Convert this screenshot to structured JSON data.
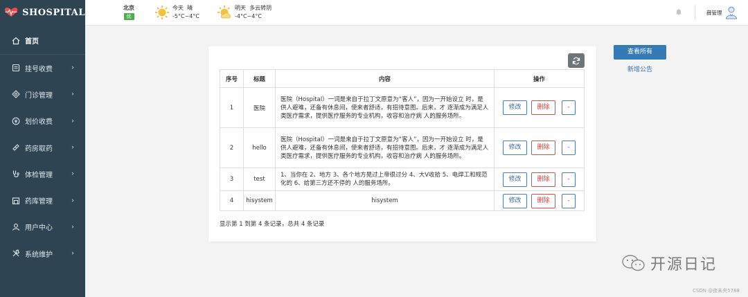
{
  "app": {
    "brand": "SHOSPITAL"
  },
  "sidebar": {
    "home": {
      "label": "首页",
      "icon": "home-icon"
    },
    "items": [
      {
        "label": "挂号收费",
        "icon": "register-icon"
      },
      {
        "label": "门诊管理",
        "icon": "clinic-icon"
      },
      {
        "label": "划价收费",
        "icon": "pricing-icon"
      },
      {
        "label": "药房取药",
        "icon": "pharmacy-icon"
      },
      {
        "label": "体检管理",
        "icon": "checkup-icon"
      },
      {
        "label": "药库管理",
        "icon": "warehouse-icon"
      },
      {
        "label": "用户中心",
        "icon": "user-icon"
      },
      {
        "label": "系统维护",
        "icon": "tools-icon"
      }
    ]
  },
  "topbar": {
    "city": "北京",
    "aqi": "优",
    "weather_today": {
      "day": "今天",
      "condition": "晴",
      "temp": "-5°C~4°C"
    },
    "weather_tomorrow": {
      "day": "明天",
      "condition": "多云转阴",
      "temp": "-4°C~4°C"
    },
    "user": "薛管理"
  },
  "table": {
    "headers": [
      "序号",
      "标题",
      "内容",
      "操作"
    ],
    "edit_label": "修改",
    "delete_label": "删除",
    "more_label": "-",
    "rows": [
      {
        "index": "1",
        "title": "医院",
        "content": "医院（Hospital）一词是来自于拉丁文原意为“客人”，因为一开始设立 时，是供人避难，还备有休息间，使来者舒适，有招待意图。后来，才 逐渐成为满足人类医疗需求，提供医疗服务的专业机构，收容和治疗病 人的服务场所。"
      },
      {
        "index": "2",
        "title": "hello",
        "content": "医院（Hospital）一词是来自于拉丁文原意为“客人”，因为一开始设立 时，是供人避难，还备有休息间，使来者舒适，有招待意图。后来，才 逐渐成为满足人类医疗需求，提供医疗服务的专业机构，收容和治疗病 人的服务场所。"
      },
      {
        "index": "3",
        "title": "test",
        "content": "1、当你在 2、地方 3、各个地方晃过上帝很过分 4、大V收拾 5、电焊工和规范化的 6、给第三方还不停的 人的服务场所。"
      },
      {
        "index": "4",
        "title": "hisystem",
        "content": "hisystem"
      }
    ],
    "footer": "显示第 1 到第 4 条记录，总共 4 条记录"
  },
  "actions": {
    "view_all": "查看所有",
    "add_notice": "新增公告"
  },
  "watermark": {
    "text": "开源日记",
    "credit": "CSDN @夜未央5788"
  }
}
